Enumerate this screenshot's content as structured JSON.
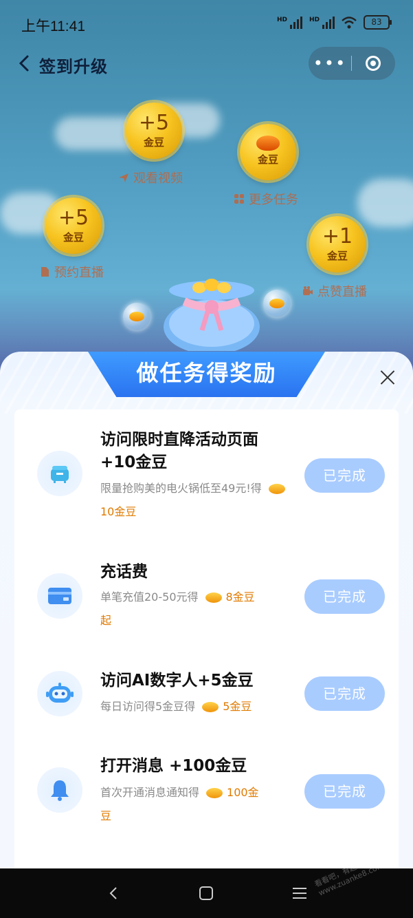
{
  "status_bar": {
    "time": "上午11:41",
    "battery": "83"
  },
  "header": {
    "title": "签到升级"
  },
  "coins": [
    {
      "value": "+5",
      "unit": "金豆",
      "label": "观看视频",
      "icon": "paper-plane-icon"
    },
    {
      "value": "",
      "unit": "金豆",
      "label": "更多任务",
      "icon": "grid-icon"
    },
    {
      "value": "+5",
      "unit": "金豆",
      "label": "预约直播",
      "icon": "document-icon"
    },
    {
      "value": "+1",
      "unit": "金豆",
      "label": "点赞直播",
      "icon": "video-camera-icon"
    }
  ],
  "panel": {
    "title": "做任务得奖励"
  },
  "tasks": [
    {
      "title": "访问限时直降活动页面+10金豆",
      "desc": "限量抢购美的电火锅低至49元!得",
      "reward": "10金豆",
      "button": "已完成",
      "icon": "rice-cooker-icon"
    },
    {
      "title": "充话费",
      "desc": "单笔充值20-50元得",
      "reward": "8金豆",
      "reward_suffix": "起",
      "button": "已完成",
      "icon": "card-icon"
    },
    {
      "title": "访问AI数字人+5金豆",
      "desc": "每日访问得5金豆得",
      "reward": "5金豆",
      "button": "已完成",
      "icon": "robot-icon"
    },
    {
      "title": "打开消息 +100金豆",
      "desc": "首次开通消息通知得",
      "reward": "100金",
      "reward_suffix": "豆",
      "button": "已完成",
      "icon": "bell-icon"
    }
  ],
  "watermark": "看看吧，有趣一起赚！ www.zuanke8.com"
}
